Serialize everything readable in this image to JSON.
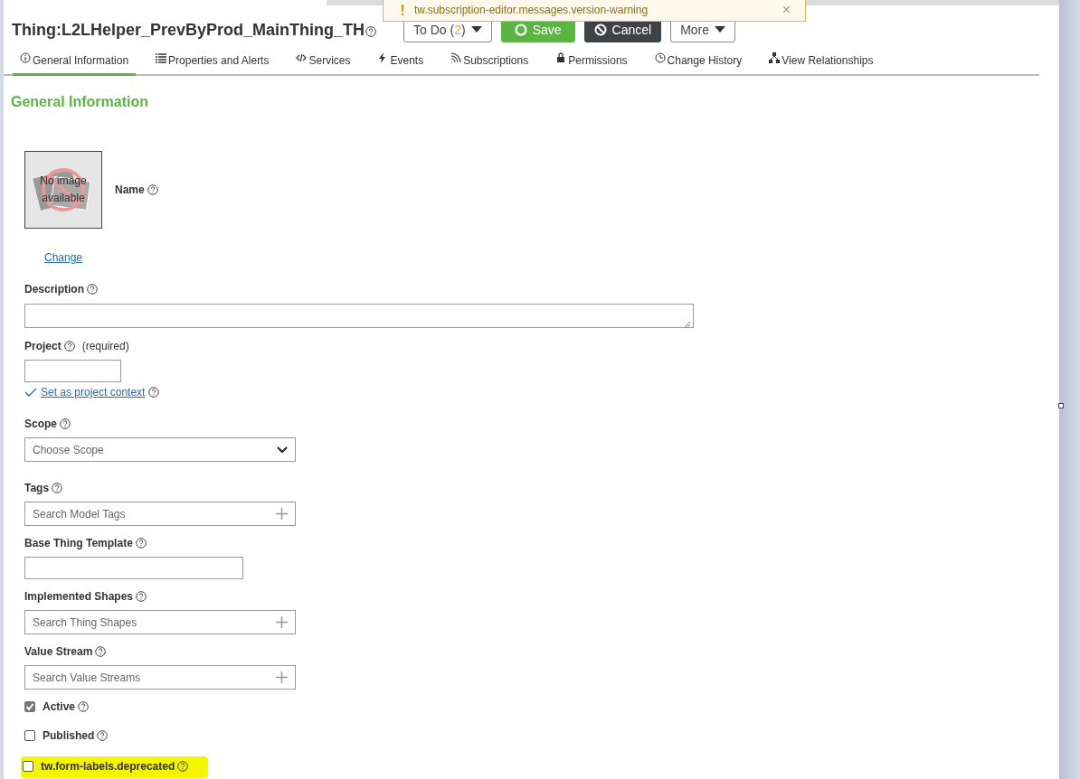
{
  "title": "Thing:L2LHelper_PrevByProd_MainThing_TH",
  "todo_button": {
    "text_before": "To Do (",
    "count": "2",
    "text_after": ")"
  },
  "buttons": [
    {
      "kind": "save",
      "label": "Save"
    },
    {
      "kind": "cancel",
      "label": "Cancel"
    },
    {
      "kind": "more",
      "label": "More"
    }
  ],
  "alert": {
    "text": "tw.subscription-editor.messages.version-warning",
    "close": "×"
  },
  "tabs": [
    {
      "kind": "info",
      "label": "General Information",
      "selected": true
    },
    {
      "kind": "list",
      "label": "Properties and Alerts",
      "selected": false
    },
    {
      "kind": "code",
      "label": "Services",
      "selected": false
    },
    {
      "kind": "bolt",
      "label": "Events",
      "selected": false
    },
    {
      "kind": "rss",
      "label": "Subscriptions",
      "selected": false
    },
    {
      "kind": "lock",
      "label": "Permissions",
      "selected": false
    },
    {
      "kind": "clock",
      "label": "Change History",
      "selected": false
    },
    {
      "kind": "tree",
      "label": "View Relationships",
      "selected": false
    }
  ],
  "section_title": "General Information",
  "image": {
    "text": "No image available",
    "link": "Change"
  },
  "name_label": "Name",
  "fields": [
    {
      "kind": "textarea",
      "label": "Description"
    },
    {
      "kind": "text",
      "label": "Project",
      "note": "(required)",
      "link": "Set as project context"
    },
    {
      "kind": "select",
      "label": "Scope",
      "placeholder": "Choose Scope"
    },
    {
      "kind": "search",
      "label": "Tags",
      "placeholder": "Search Model Tags"
    },
    {
      "kind": "short",
      "label": "Base Thing Template"
    },
    {
      "kind": "search",
      "label": "Implemented Shapes",
      "placeholder": "Search Thing Shapes"
    },
    {
      "kind": "search",
      "label": "Value Stream",
      "placeholder": "Search Value Streams"
    },
    {
      "kind": "checkbox",
      "label": "Active",
      "checked": true,
      "highlighted": false
    },
    {
      "kind": "checkbox",
      "label": "Published",
      "checked": false,
      "highlighted": false
    },
    {
      "kind": "checkbox",
      "label": "tw.form-labels.deprecated",
      "checked": false,
      "highlighted": true
    }
  ]
}
